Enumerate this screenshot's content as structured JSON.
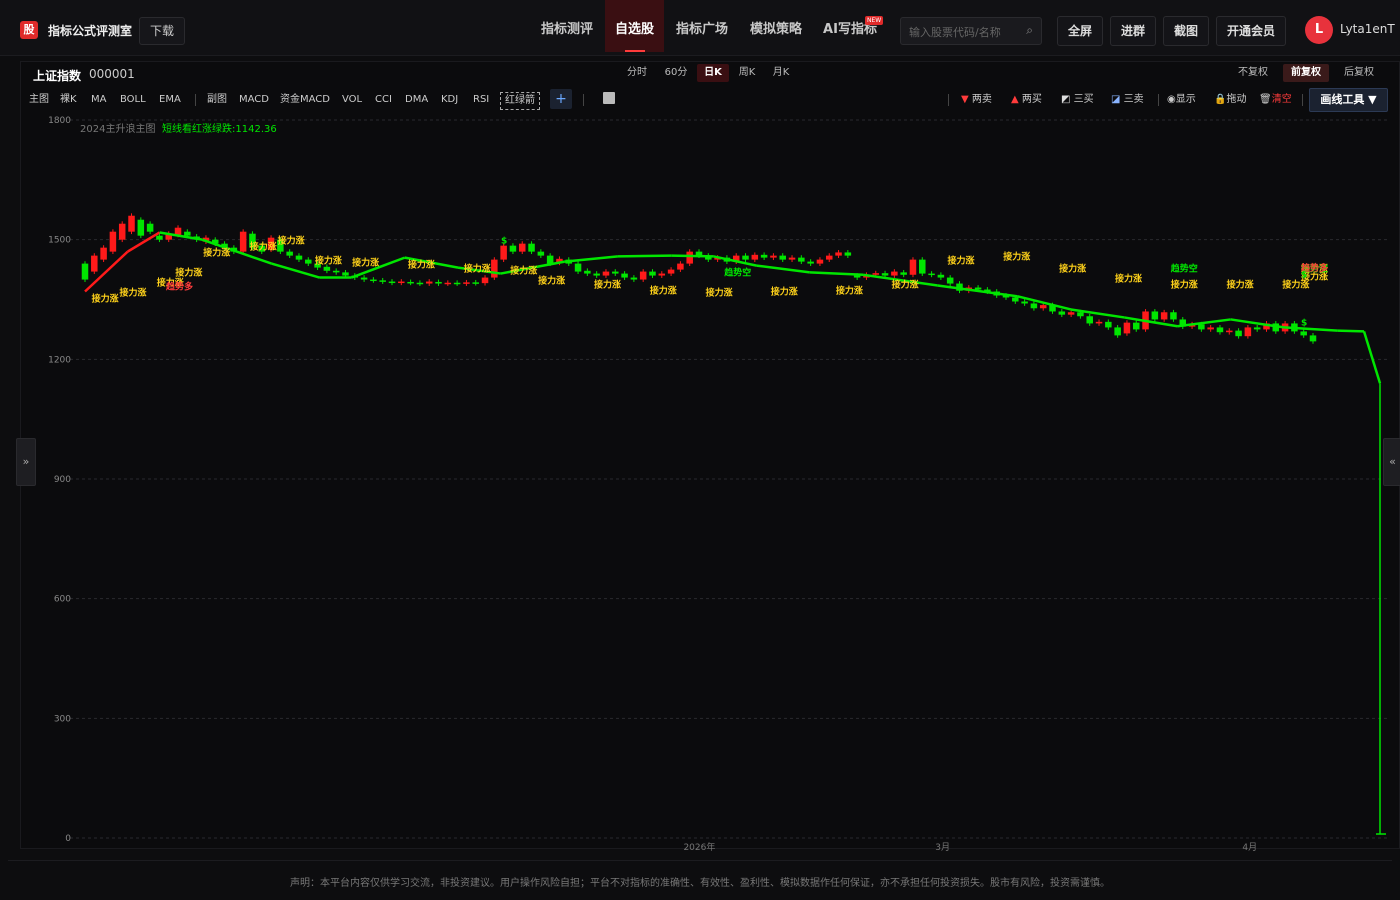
{
  "header": {
    "logo_char": "股",
    "app_title": "指标公式评测室",
    "download_label": "下载",
    "nav": [
      "指标测评",
      "自选股",
      "指标广场",
      "模拟策略",
      "AI写指标"
    ],
    "new_badge": "NEW",
    "search_placeholder": "输入股票代码/名称",
    "buttons": [
      "全屏",
      "进群",
      "截图",
      "开通会员"
    ],
    "avatar_letter": "L",
    "username": "Lyta1enT"
  },
  "toolbar": {
    "symbol_name": "上证指数",
    "symbol_code": "000001",
    "periods": [
      "分时",
      "60分",
      "日K",
      "周K",
      "月K"
    ],
    "active_period": "日K",
    "adjust": [
      "不复权",
      "前复权",
      "后复权"
    ],
    "active_adjust": "前复权",
    "main_indicators": [
      "主图",
      "裸K",
      "MA",
      "BOLL",
      "EMA"
    ],
    "sub_indicators": [
      "副图",
      "MACD",
      "资金MACD",
      "VOL",
      "CCI",
      "DMA",
      "KDJ",
      "RSI"
    ],
    "boxed_indicator": "红绿箭",
    "add_label": "+",
    "tools": [
      "两卖",
      "两买",
      "三买",
      "三卖",
      "显示",
      "拖动",
      "清空"
    ],
    "draw_tools_label": "画线工具 ▼"
  },
  "chart_data": {
    "type": "candlestick",
    "indicator_title": "2024主升浪主图",
    "indicator_value_label": "短线看红涨绿跌:1142.36",
    "y_ticks": [
      1800,
      1500,
      1200,
      900,
      600,
      300,
      0
    ],
    "ylim": [
      0,
      1800
    ],
    "x_ticks": [
      "2026年",
      "3月",
      "4月"
    ],
    "annotation_labels": [
      "接力涨",
      "趋势空",
      "趋势多",
      "$"
    ],
    "candles": [
      [
        1440,
        1400
      ],
      [
        1420,
        1460
      ],
      [
        1450,
        1480
      ],
      [
        1470,
        1520
      ],
      [
        1500,
        1540
      ],
      [
        1520,
        1560
      ],
      [
        1550,
        1510
      ],
      [
        1540,
        1520
      ],
      [
        1510,
        1500
      ],
      [
        1500,
        1515
      ],
      [
        1512,
        1530
      ],
      [
        1520,
        1510
      ],
      [
        1508,
        1500
      ],
      [
        1495,
        1505
      ],
      [
        1500,
        1490
      ],
      [
        1490,
        1480
      ],
      [
        1480,
        1470
      ],
      [
        1470,
        1520
      ],
      [
        1515,
        1480
      ],
      [
        1485,
        1470
      ],
      [
        1475,
        1505
      ],
      [
        1500,
        1470
      ],
      [
        1470,
        1460
      ],
      [
        1460,
        1450
      ],
      [
        1450,
        1440
      ],
      [
        1440,
        1430
      ],
      [
        1432,
        1422
      ],
      [
        1422,
        1418
      ],
      [
        1418,
        1410
      ],
      [
        1410,
        1405
      ],
      [
        1405,
        1400
      ],
      [
        1400,
        1398
      ],
      [
        1398,
        1395
      ],
      [
        1395,
        1392
      ],
      [
        1392,
        1395
      ],
      [
        1394,
        1392
      ],
      [
        1392,
        1390
      ],
      [
        1390,
        1395
      ],
      [
        1394,
        1390
      ],
      [
        1390,
        1392
      ],
      [
        1392,
        1390
      ],
      [
        1390,
        1393
      ],
      [
        1393,
        1391
      ],
      [
        1391,
        1405
      ],
      [
        1405,
        1450
      ],
      [
        1450,
        1485
      ],
      [
        1485,
        1470
      ],
      [
        1470,
        1490
      ],
      [
        1490,
        1470
      ],
      [
        1470,
        1460
      ],
      [
        1460,
        1440
      ],
      [
        1442,
        1452
      ],
      [
        1450,
        1440
      ],
      [
        1440,
        1420
      ],
      [
        1422,
        1415
      ],
      [
        1415,
        1410
      ],
      [
        1410,
        1420
      ],
      [
        1420,
        1415
      ],
      [
        1415,
        1405
      ],
      [
        1405,
        1400
      ],
      [
        1400,
        1420
      ],
      [
        1420,
        1410
      ],
      [
        1410,
        1415
      ],
      [
        1415,
        1425
      ],
      [
        1425,
        1440
      ],
      [
        1440,
        1470
      ],
      [
        1470,
        1460
      ],
      [
        1460,
        1450
      ],
      [
        1450,
        1455
      ],
      [
        1455,
        1445
      ],
      [
        1445,
        1460
      ],
      [
        1460,
        1450
      ],
      [
        1450,
        1462
      ],
      [
        1462,
        1455
      ],
      [
        1455,
        1460
      ],
      [
        1460,
        1450
      ],
      [
        1450,
        1455
      ],
      [
        1455,
        1445
      ],
      [
        1445,
        1440
      ],
      [
        1440,
        1450
      ],
      [
        1450,
        1460
      ],
      [
        1460,
        1468
      ],
      [
        1468,
        1460
      ],
      [
        1410,
        1405
      ],
      [
        1405,
        1412
      ],
      [
        1412,
        1416
      ],
      [
        1416,
        1410
      ],
      [
        1410,
        1420
      ],
      [
        1418,
        1412
      ],
      [
        1412,
        1450
      ],
      [
        1450,
        1415
      ],
      [
        1415,
        1412
      ],
      [
        1412,
        1405
      ],
      [
        1405,
        1390
      ],
      [
        1390,
        1372
      ],
      [
        1372,
        1380
      ],
      [
        1380,
        1375
      ],
      [
        1375,
        1370
      ],
      [
        1370,
        1360
      ],
      [
        1360,
        1355
      ],
      [
        1355,
        1345
      ],
      [
        1345,
        1340
      ],
      [
        1340,
        1328
      ],
      [
        1328,
        1336
      ],
      [
        1336,
        1320
      ],
      [
        1320,
        1312
      ],
      [
        1312,
        1318
      ],
      [
        1318,
        1308
      ],
      [
        1308,
        1290
      ],
      [
        1290,
        1294
      ],
      [
        1294,
        1280
      ],
      [
        1280,
        1260
      ],
      [
        1265,
        1292
      ],
      [
        1292,
        1275
      ],
      [
        1275,
        1320
      ],
      [
        1320,
        1300
      ],
      [
        1300,
        1318
      ],
      [
        1318,
        1300
      ],
      [
        1300,
        1282
      ],
      [
        1282,
        1288
      ],
      [
        1288,
        1275
      ],
      [
        1275,
        1280
      ],
      [
        1280,
        1268
      ],
      [
        1268,
        1272
      ],
      [
        1272,
        1258
      ],
      [
        1258,
        1280
      ],
      [
        1280,
        1275
      ],
      [
        1275,
        1290
      ],
      [
        1290,
        1270
      ],
      [
        1270,
        1290
      ],
      [
        1290,
        1270
      ],
      [
        1270,
        1260
      ],
      [
        1260,
        1245
      ]
    ],
    "trend_line": [
      [
        0,
        1370
      ],
      [
        8,
        1470
      ],
      [
        14,
        1518
      ],
      [
        22,
        1500
      ],
      [
        35,
        1440
      ],
      [
        44,
        1405
      ],
      [
        50,
        1405
      ],
      [
        60,
        1455
      ],
      [
        70,
        1430
      ],
      [
        78,
        1415
      ],
      [
        90,
        1445
      ],
      [
        100,
        1458
      ],
      [
        110,
        1460
      ],
      [
        118,
        1458
      ],
      [
        126,
        1435
      ],
      [
        136,
        1418
      ],
      [
        146,
        1412
      ],
      [
        160,
        1385
      ],
      [
        175,
        1358
      ],
      [
        185,
        1325
      ],
      [
        195,
        1305
      ],
      [
        205,
        1283
      ],
      [
        215,
        1300
      ],
      [
        225,
        1280
      ],
      [
        235,
        1272
      ],
      [
        240,
        1270
      ],
      [
        243,
        1140
      ]
    ],
    "last_point": [
      243,
      10
    ]
  },
  "disclaimer": "声明：本平台内容仅供学习交流，非投资建议。用户操作风险自担；平台不对指标的准确性、有效性、盈利性、模拟数据作任何保证，亦不承担任何投资损失。股市有风险，投资需谨慎。",
  "colors": {
    "up": "#ff1a1a",
    "down": "#00e600",
    "accent": "#e02a2a",
    "label": "#ffd21a"
  }
}
